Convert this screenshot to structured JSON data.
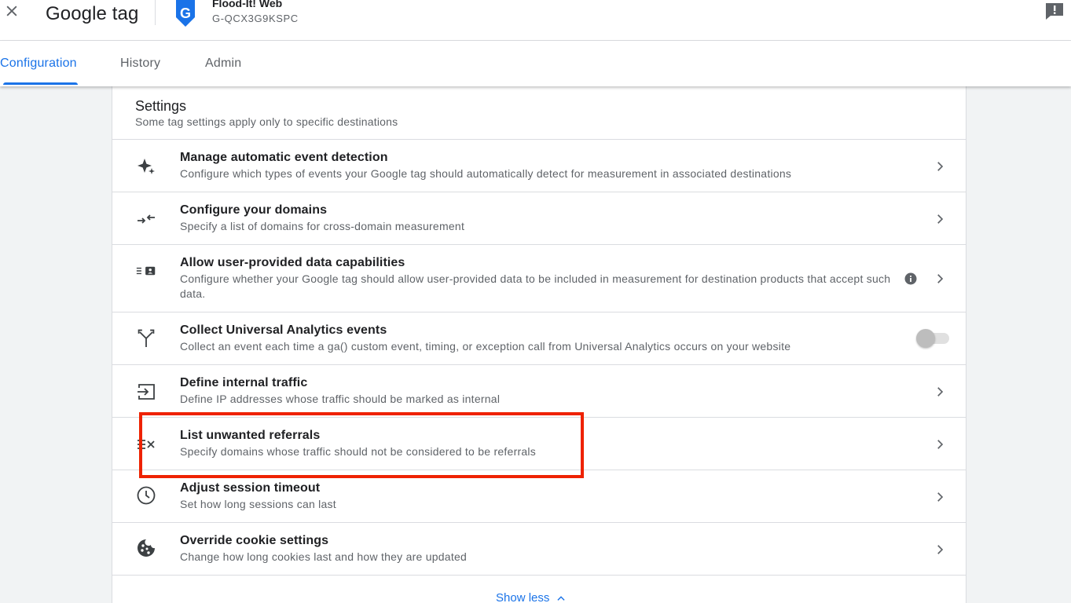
{
  "header": {
    "app_title": "Google tag",
    "container_name": "Flood-It! Web",
    "container_id": "G-QCX3G9KSPC"
  },
  "tabs": [
    {
      "label": "Configuration",
      "active": true
    },
    {
      "label": "History",
      "active": false
    },
    {
      "label": "Admin",
      "active": false
    }
  ],
  "settings": {
    "title": "Settings",
    "subtitle": "Some tag settings apply only to specific destinations",
    "items": [
      {
        "title": "Manage automatic event detection",
        "description": "Configure which types of events your Google tag should automatically detect for measurement in associated destinations",
        "icon": "sparkle-icon",
        "control": "chevron"
      },
      {
        "title": "Configure your domains",
        "description": "Specify a list of domains for cross-domain measurement",
        "icon": "arrows-inward-icon",
        "control": "chevron"
      },
      {
        "title": "Allow user-provided data capabilities",
        "description": "Configure whether your Google tag should allow user-provided data to be included in measurement for destination products that accept such data.",
        "icon": "user-data-icon",
        "control": "chevron",
        "info": true
      },
      {
        "title": "Collect Universal Analytics events",
        "description": "Collect an event each time a ga() custom event, timing, or exception call from Universal Analytics occurs on your website",
        "icon": "merge-icon",
        "control": "toggle",
        "toggle_on": false
      },
      {
        "title": "Define internal traffic",
        "description": "Define IP addresses whose traffic should be marked as internal",
        "icon": "input-icon",
        "control": "chevron"
      },
      {
        "title": "List unwanted referrals",
        "description": "Specify domains whose traffic should not be considered to be referrals",
        "icon": "list-x-icon",
        "control": "chevron",
        "highlighted": true
      },
      {
        "title": "Adjust session timeout",
        "description": "Set how long sessions can last",
        "icon": "clock-icon",
        "control": "chevron"
      },
      {
        "title": "Override cookie settings",
        "description": "Change how long cookies last and how they are updated",
        "icon": "cookie-icon",
        "control": "chevron"
      }
    ],
    "show_less_label": "Show less"
  },
  "colors": {
    "accent": "#1a73e8",
    "highlight": "#ee2200",
    "text_primary": "#202124",
    "text_secondary": "#5f6368",
    "background": "#f1f3f4"
  }
}
